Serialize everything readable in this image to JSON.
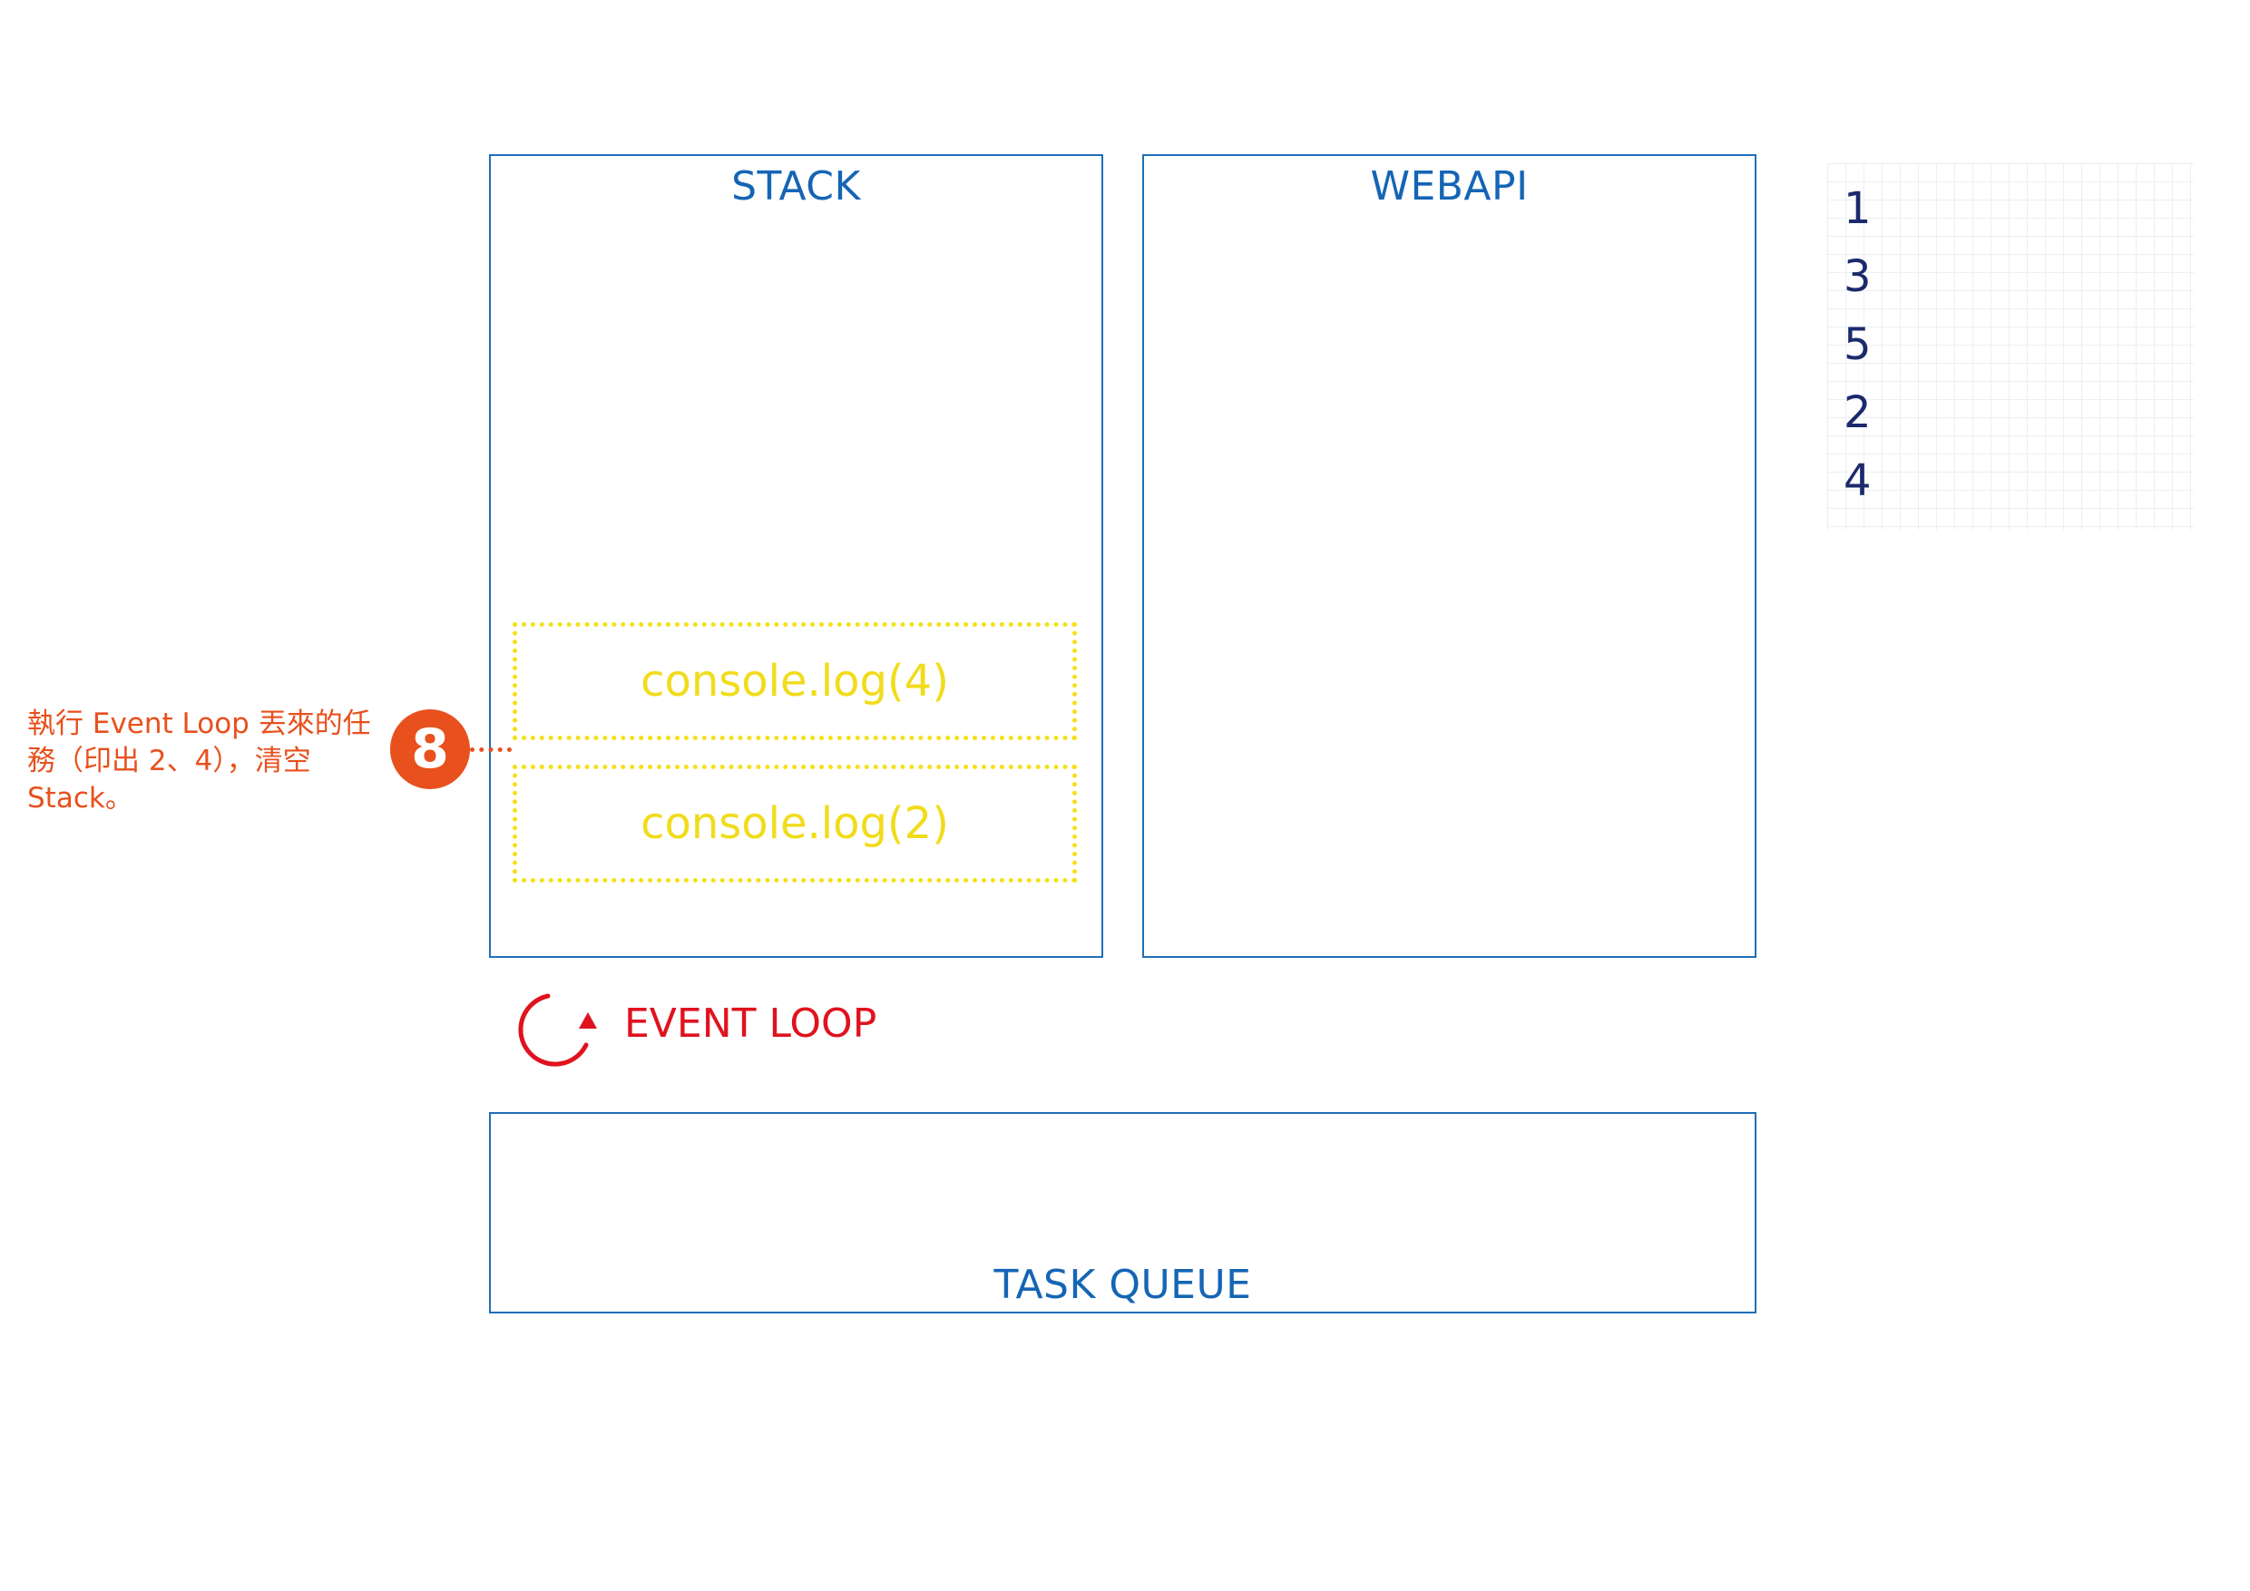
{
  "diagram": {
    "stack": {
      "title": "STACK",
      "frames": [
        "console.log(4)",
        "console.log(2)"
      ]
    },
    "webapi": {
      "title": "WEBAPI"
    },
    "task_queue": {
      "title": "TASK QUEUE"
    },
    "event_loop": {
      "label": "EVENT LOOP",
      "icon": "circular-arrow-icon"
    },
    "output": {
      "lines": [
        "1",
        "3",
        "5",
        "2",
        "4"
      ]
    },
    "step": {
      "number": "8",
      "note": "執行 Event Loop 丟來的任\n務（印出 2、4），清空\nStack。"
    },
    "colors": {
      "box_border": "#1f6fba",
      "box_title": "#1565b5",
      "frame": "#f5e016",
      "step_accent": "#e8501d",
      "event_loop": "#e0121e",
      "output_text": "#1b2a6b"
    }
  }
}
